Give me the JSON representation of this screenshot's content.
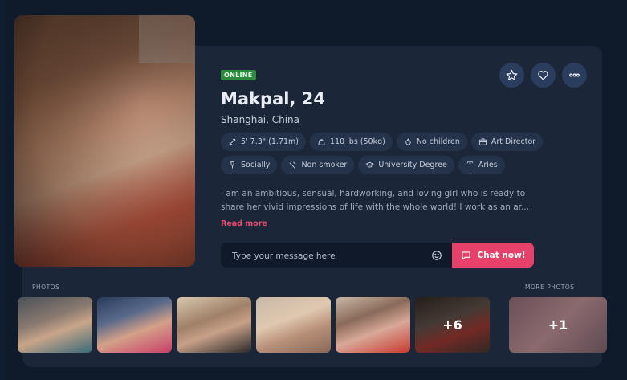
{
  "profile": {
    "status": "ONLINE",
    "name": "Makpal, 24",
    "location": "Shanghai, China",
    "bio": "I am an ambitious, sensual, hardworking, and loving girl who is ready to share her vivid impressions of life with the whole world! I work as an ar...",
    "read_more": "Read more"
  },
  "actions": {
    "favorite_icon": "star-icon",
    "like_icon": "heart-icon",
    "more_icon": "more-icon"
  },
  "attributes": [
    {
      "label": "5' 7.3\" (1.71m)",
      "icon": "height-icon"
    },
    {
      "label": "110 lbs (50kg)",
      "icon": "weight-icon"
    },
    {
      "label": "No children",
      "icon": "children-icon"
    },
    {
      "label": "Art Director",
      "icon": "briefcase-icon"
    },
    {
      "label": "Socially",
      "icon": "drink-icon"
    },
    {
      "label": "Non smoker",
      "icon": "smoking-icon"
    },
    {
      "label": "University Degree",
      "icon": "education-icon"
    },
    {
      "label": "Aries",
      "icon": "zodiac-icon"
    }
  ],
  "message": {
    "placeholder": "Type your message here",
    "chat_label": "Chat now!"
  },
  "photos": {
    "label": "PHOTOS",
    "extra_count": "+6",
    "more_label": "MORE PHOTOS",
    "more_count": "+1"
  },
  "colors": {
    "background": "#0f1a2b",
    "card": "#1b2638",
    "accent": "#e5416a",
    "online": "#2c8a3e"
  }
}
